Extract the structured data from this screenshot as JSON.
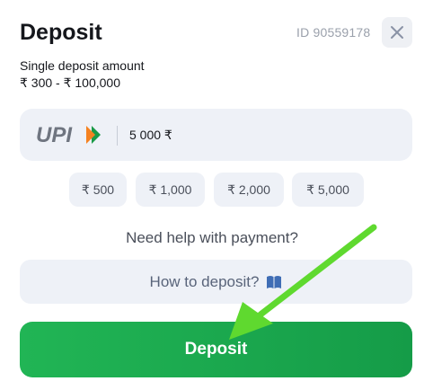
{
  "header": {
    "title": "Deposit",
    "id_text": "ID 90559178",
    "close_icon": "close-icon"
  },
  "limits": {
    "label": "Single deposit amount",
    "range": "₹ 300 - ₹ 100,000"
  },
  "amount_field": {
    "method": "UPI",
    "value": "5 000 ₹"
  },
  "quick_amounts": [
    "₹ 500",
    "₹ 1,000",
    "₹ 2,000",
    "₹ 5,000"
  ],
  "help": {
    "text": "Need help with payment?",
    "button_label": "How to deposit?",
    "button_icon": "book-icon"
  },
  "submit": {
    "label": "Deposit",
    "color": "#1ea94f"
  },
  "annotation": {
    "arrow_color": "#5fd92f"
  }
}
